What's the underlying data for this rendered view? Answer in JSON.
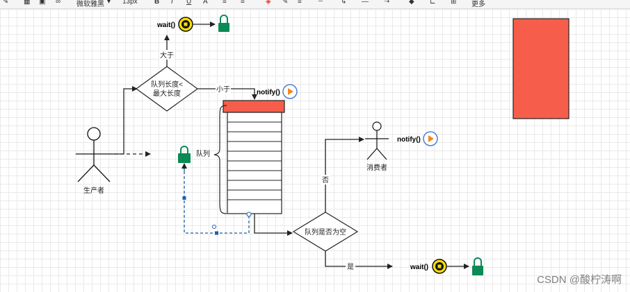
{
  "toolbar": {
    "font_name": "微软雅黑",
    "font_size": "13px",
    "more": "更多"
  },
  "diagram": {
    "producer_label": "生产者",
    "consumer_label": "消费者",
    "decision_top_line1": "队列长度<",
    "decision_top_line2": "最大长度",
    "label_greater": "大于",
    "label_less": "小于",
    "queue_label": "队列",
    "decision_bottom": "队列是否为空",
    "label_no": "否",
    "label_yes": "是",
    "wait_top": "wait()",
    "notify_top": "notify()",
    "notify_consumer": "notify()",
    "wait_bottom": "wait()"
  },
  "colors": {
    "accent_red": "#f65e4b",
    "lock_green": "#0b8a56",
    "wait_yellow": "#ffe000",
    "play_orange": "#f08a1c",
    "dash_blue": "#1f5fa8"
  },
  "watermark": "CSDN @酸柠涛啊"
}
